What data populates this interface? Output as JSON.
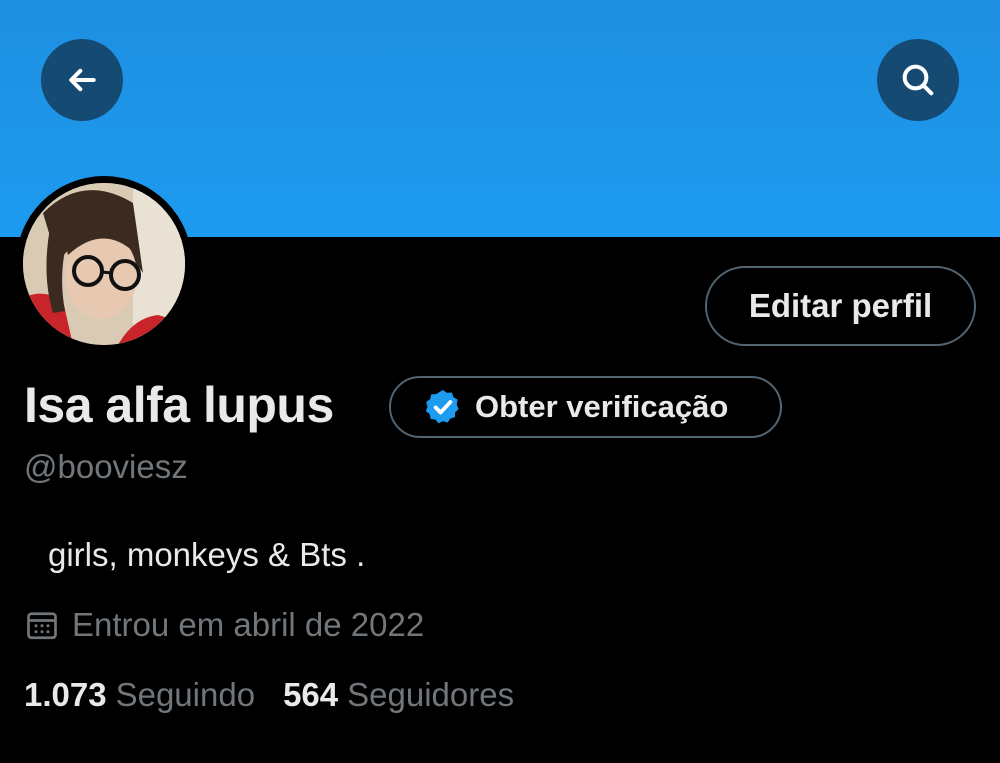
{
  "header": {
    "back_icon": "arrow-left-icon",
    "search_icon": "search-icon",
    "banner_color": "#1d9bf0",
    "button_bg": "#154a73"
  },
  "profile": {
    "display_name": "Isa alfa lupus",
    "handle": "@booviesz",
    "bio": "girls, monkeys & Bts .",
    "joined": "Entrou em abril de 2022",
    "avatar_icon": "profile-photo",
    "edit_label": "Editar perfil",
    "verify_label": "Obter verificação",
    "verify_icon": "verified-badge-icon",
    "verified_color": "#1d9bf0"
  },
  "stats": {
    "following_count": "1.073",
    "following_label": "Seguindo",
    "followers_count": "564",
    "followers_label": "Seguidores"
  }
}
